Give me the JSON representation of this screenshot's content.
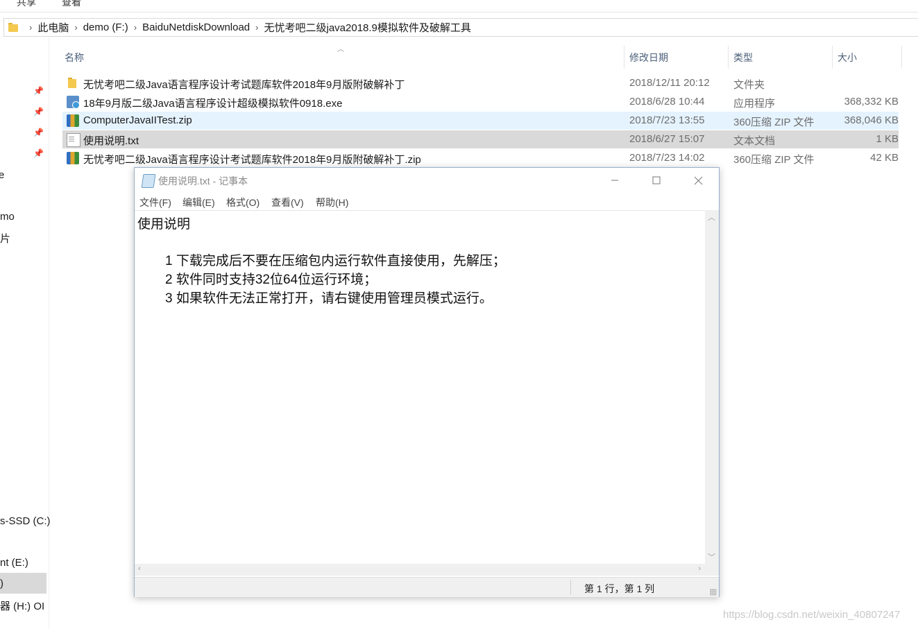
{
  "ribbon": {
    "tab_share": "共享",
    "tab_view": "查看"
  },
  "breadcrumb": {
    "items": [
      "此电脑",
      "demo (F:)",
      "BaiduNetdiskDownload",
      "无忧考吧二级java2018.9模拟软件及破解工具"
    ]
  },
  "navpane": {
    "fragments": [
      "e",
      "mo",
      "片",
      "s-SSD (C:)",
      "nt (E:)",
      ")",
      "器 (H:) OI"
    ]
  },
  "columns": {
    "name": "名称",
    "modified": "修改日期",
    "type": "类型",
    "size": "大小"
  },
  "files": [
    {
      "name": "无忧考吧二级Java语言程序设计考试题库软件2018年9月版附破解补丁",
      "date": "2018/12/11 20:12",
      "type": "文件夹",
      "size": "",
      "icon": "folder-icon"
    },
    {
      "name": "18年9月版二级Java语言程序设计超级模拟软件0918.exe",
      "date": "2018/6/28 10:44",
      "type": "应用程序",
      "size": "368,332 KB",
      "icon": "exe-icon"
    },
    {
      "name": "ComputerJavaIITest.zip",
      "date": "2018/7/23 13:55",
      "type": "360压缩 ZIP 文件",
      "size": "368,046 KB",
      "icon": "zip-icon"
    },
    {
      "name": "使用说明.txt",
      "date": "2018/6/27 15:07",
      "type": "文本文档",
      "size": "1 KB",
      "icon": "txt-icon"
    },
    {
      "name": "无忧考吧二级Java语言程序设计考试题库软件2018年9月版附破解补丁.zip",
      "date": "2018/7/23 14:02",
      "type": "360压缩 ZIP 文件",
      "size": "42 KB",
      "icon": "zip-icon"
    }
  ],
  "notepad": {
    "title": "使用说明.txt - 记事本",
    "menu": [
      "文件(F)",
      "编辑(E)",
      "格式(O)",
      "查看(V)",
      "帮助(H)"
    ],
    "content": {
      "heading": "使用说明",
      "line1": "1 下载完成后不要在压缩包内运行软件直接使用，先解压；",
      "line2": "2 软件同时支持32位64位运行环境；",
      "line3": "3 如果软件无法正常打开，请右键使用管理员模式运行。"
    },
    "status": "第 1 行，第 1 列"
  },
  "watermark": "https://blog.csdn.net/weixin_40807247",
  "colors": {
    "selection": "#d9d9d9",
    "hover": "#e5f3ff",
    "header_text": "#4c607a"
  }
}
